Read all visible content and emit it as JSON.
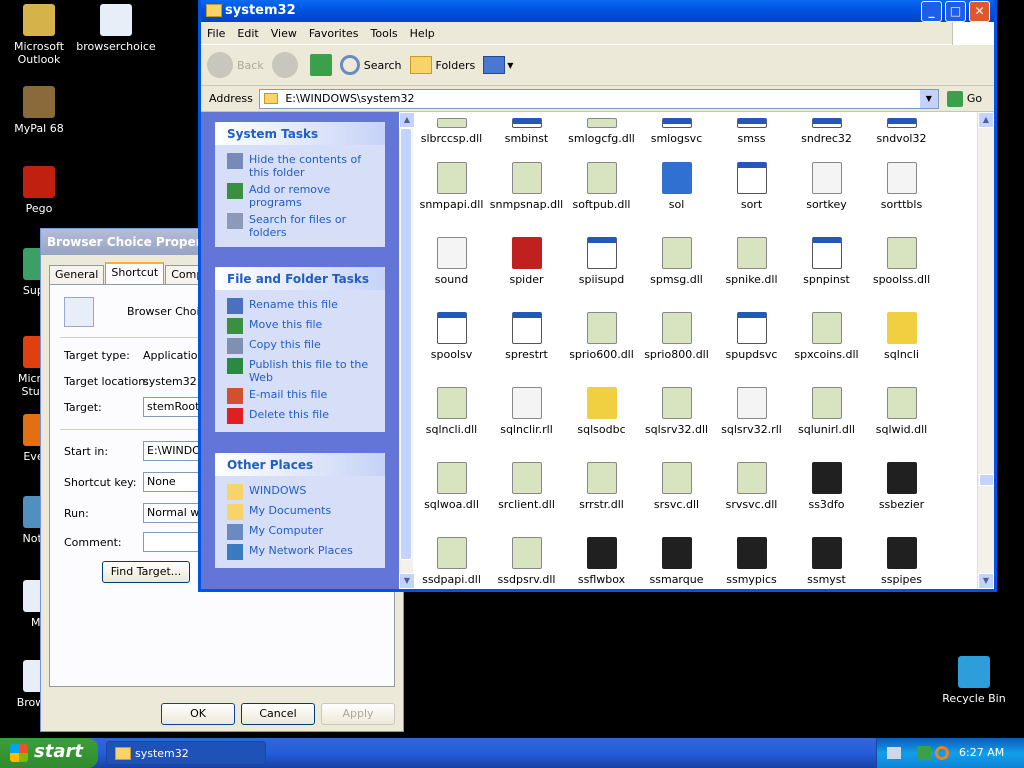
{
  "desktop": {
    "icons": [
      {
        "label": "Microsoft Outlook",
        "icon": "outlook-icon",
        "color": "#d6b34a"
      },
      {
        "label": "browserchoice",
        "icon": "shortcut-doc-icon",
        "color": "#e8eef8"
      },
      {
        "label": "MyPal 68",
        "icon": "mypal-icon",
        "color": "#8a6a3a"
      },
      {
        "label": "Pego",
        "icon": "pego-icon",
        "color": "#c02010"
      },
      {
        "label": "Super",
        "icon": "super-icon",
        "color": "#3aa066"
      },
      {
        "label": "Microso Studio",
        "icon": "studio-icon",
        "color": "#e04010"
      },
      {
        "label": "Every",
        "icon": "every-icon",
        "color": "#e07010"
      },
      {
        "label": "Notep",
        "icon": "notepad-icon",
        "color": "#5090c0"
      },
      {
        "label": "My",
        "icon": "my-icon",
        "color": "#e8eef8"
      },
      {
        "label": "Browser",
        "icon": "browser-shortcut-icon",
        "color": "#e8eef8"
      },
      {
        "label": "Recycle Bin",
        "icon": "recycle-bin-icon",
        "color": "#2e9edb"
      }
    ]
  },
  "properties": {
    "title": "Browser Choice Properti",
    "tabs": [
      "General",
      "Shortcut",
      "Compatib"
    ],
    "name": "Browser Choice",
    "target_type_label": "Target type:",
    "target_type": "Application",
    "target_location_label": "Target location:",
    "target_location": "system32",
    "target_label": "Target:",
    "target_value": "stemRoot%",
    "start_in_label": "Start in:",
    "start_in": "E:\\WINDO",
    "shortcut_key_label": "Shortcut key:",
    "shortcut_key": "None",
    "run_label": "Run:",
    "run": "Normal win",
    "comment_label": "Comment:",
    "find_target": "Find Target...",
    "ok": "OK",
    "cancel": "Cancel",
    "apply": "Apply"
  },
  "explorer": {
    "title": "system32",
    "menu": [
      "File",
      "Edit",
      "View",
      "Favorites",
      "Tools",
      "Help"
    ],
    "toolbar": {
      "back": "Back",
      "search": "Search",
      "folders": "Folders"
    },
    "address_label": "Address",
    "address": "E:\\WINDOWS\\system32",
    "go": "Go",
    "panels": [
      {
        "title": "System Tasks",
        "items": [
          "Hide the contents of this folder",
          "Add or remove programs",
          "Search for files or folders"
        ]
      },
      {
        "title": "File and Folder Tasks",
        "items": [
          "Rename this file",
          "Move this file",
          "Copy this file",
          "Publish this file to the Web",
          "E-mail this file",
          "Delete this file"
        ]
      },
      {
        "title": "Other Places",
        "items": [
          "WINDOWS",
          "My Documents",
          "My Computer",
          "My Network Places"
        ]
      }
    ],
    "files": [
      {
        "name": "slbrccsp.dll",
        "kind": "dll"
      },
      {
        "name": "smbinst",
        "kind": "exe"
      },
      {
        "name": "smlogcfg.dll",
        "kind": "dll"
      },
      {
        "name": "smlogsvc",
        "kind": "exe"
      },
      {
        "name": "smss",
        "kind": "exe"
      },
      {
        "name": "sndrec32",
        "kind": "exe"
      },
      {
        "name": "sndvol32",
        "kind": "exe"
      },
      {
        "name": "snmpapi.dll",
        "kind": "dll"
      },
      {
        "name": "snmpsnap.dll",
        "kind": "dll"
      },
      {
        "name": "softpub.dll",
        "kind": "dll"
      },
      {
        "name": "sol",
        "kind": "cards"
      },
      {
        "name": "sort",
        "kind": "exe"
      },
      {
        "name": "sortkey",
        "kind": "nls"
      },
      {
        "name": "sorttbls",
        "kind": "nls"
      },
      {
        "name": "sound",
        "kind": "nls"
      },
      {
        "name": "spider",
        "kind": "spider"
      },
      {
        "name": "spiisupd",
        "kind": "exe"
      },
      {
        "name": "spmsg.dll",
        "kind": "dll"
      },
      {
        "name": "spnike.dll",
        "kind": "dll"
      },
      {
        "name": "spnpinst",
        "kind": "exe"
      },
      {
        "name": "spoolss.dll",
        "kind": "dll"
      },
      {
        "name": "spoolsv",
        "kind": "exe"
      },
      {
        "name": "sprestrt",
        "kind": "exe"
      },
      {
        "name": "sprio600.dll",
        "kind": "dll"
      },
      {
        "name": "sprio800.dll",
        "kind": "dll"
      },
      {
        "name": "spupdsvc",
        "kind": "exe"
      },
      {
        "name": "spxcoins.dll",
        "kind": "dll"
      },
      {
        "name": "sqlncli",
        "kind": "unknown"
      },
      {
        "name": "sqlncli.dll",
        "kind": "dll"
      },
      {
        "name": "sqlnclir.rll",
        "kind": "nls"
      },
      {
        "name": "sqlsodbc",
        "kind": "unknown"
      },
      {
        "name": "sqlsrv32.dll",
        "kind": "dll"
      },
      {
        "name": "sqlsrv32.rll",
        "kind": "nls"
      },
      {
        "name": "sqlunirl.dll",
        "kind": "dll"
      },
      {
        "name": "sqlwid.dll",
        "kind": "dll"
      },
      {
        "name": "sqlwoa.dll",
        "kind": "dll"
      },
      {
        "name": "srclient.dll",
        "kind": "dll"
      },
      {
        "name": "srrstr.dll",
        "kind": "dll"
      },
      {
        "name": "srsvc.dll",
        "kind": "dll"
      },
      {
        "name": "srvsvc.dll",
        "kind": "dll"
      },
      {
        "name": "ss3dfo",
        "kind": "scr"
      },
      {
        "name": "ssbezier",
        "kind": "scr"
      },
      {
        "name": "ssdpapi.dll",
        "kind": "dll"
      },
      {
        "name": "ssdpsrv.dll",
        "kind": "dll"
      },
      {
        "name": "ssflwbox",
        "kind": "scr"
      },
      {
        "name": "ssmarque",
        "kind": "scr"
      },
      {
        "name": "ssmypics",
        "kind": "scr"
      },
      {
        "name": "ssmyst",
        "kind": "scr"
      },
      {
        "name": "sspipes",
        "kind": "scr"
      }
    ]
  },
  "taskbar": {
    "start": "start",
    "task": "system32",
    "time": "6:27 AM"
  },
  "colors": {
    "dll": "#d8e4c0",
    "exe": "#2458b8",
    "nls": "#f4f4f4",
    "unknown": "#f0d040",
    "scr": "#202020",
    "cards": "#3070d0",
    "spider": "#c02020"
  }
}
